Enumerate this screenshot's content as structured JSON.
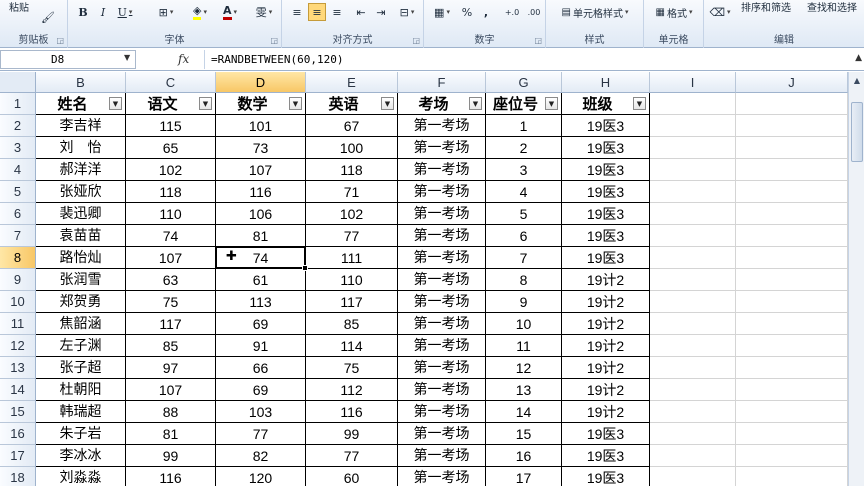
{
  "ribbon": {
    "clipboard": {
      "paste_label": "粘贴",
      "group_label": "剪贴板"
    },
    "font": {
      "group_label": "字体",
      "bold": "B",
      "italic": "I",
      "underline": "U",
      "fill_color": "#ffff00",
      "font_color": "#c00000",
      "font_color_glyph": "A",
      "pinyin_glyph": "雯"
    },
    "alignment": {
      "group_label": "对齐方式"
    },
    "number": {
      "group_label": "数字",
      "percent": "%",
      "comma": ",",
      "inc_decimal": "←.0 .00",
      "dec_decimal": ".00 →.0"
    },
    "styles": {
      "group_label": "样式",
      "cell_styles": "单元格样式"
    },
    "cells": {
      "group_label": "单元格",
      "format": "格式"
    },
    "editing": {
      "group_label": "编辑",
      "sort_filter": "排序和筛选",
      "find_select": "查找和选择"
    }
  },
  "formula_bar": {
    "name_box": "D8",
    "fx": "fx",
    "formula": "=RANDBETWEEN(60,120)"
  },
  "grid": {
    "columns": [
      "B",
      "C",
      "D",
      "E",
      "F",
      "G",
      "H",
      "I",
      "J"
    ],
    "selected_column": "D",
    "selected_row": 8,
    "headers": [
      "姓名",
      "语文",
      "数学",
      "英语",
      "考场",
      "座位号",
      "班级"
    ],
    "rows": [
      {
        "num": "1"
      },
      {
        "num": "2",
        "cells": [
          "李吉祥",
          "115",
          "101",
          "67",
          "第一考场",
          "1",
          "19医3"
        ]
      },
      {
        "num": "3",
        "cells": [
          "刘　怡",
          "65",
          "73",
          "100",
          "第一考场",
          "2",
          "19医3"
        ]
      },
      {
        "num": "4",
        "cells": [
          "郝洋洋",
          "102",
          "107",
          "118",
          "第一考场",
          "3",
          "19医3"
        ]
      },
      {
        "num": "5",
        "cells": [
          "张娅欣",
          "118",
          "116",
          "71",
          "第一考场",
          "4",
          "19医3"
        ]
      },
      {
        "num": "6",
        "cells": [
          "裴迅卿",
          "110",
          "106",
          "102",
          "第一考场",
          "5",
          "19医3"
        ]
      },
      {
        "num": "7",
        "cells": [
          "袁苗苗",
          "74",
          "81",
          "77",
          "第一考场",
          "6",
          "19医3"
        ]
      },
      {
        "num": "8",
        "cells": [
          "路怡灿",
          "107",
          "74",
          "111",
          "第一考场",
          "7",
          "19医3"
        ]
      },
      {
        "num": "9",
        "cells": [
          "张润雪",
          "63",
          "61",
          "110",
          "第一考场",
          "8",
          "19计2"
        ]
      },
      {
        "num": "10",
        "cells": [
          "郑贺勇",
          "75",
          "113",
          "117",
          "第一考场",
          "9",
          "19计2"
        ]
      },
      {
        "num": "11",
        "cells": [
          "焦韶涵",
          "117",
          "69",
          "85",
          "第一考场",
          "10",
          "19计2"
        ]
      },
      {
        "num": "12",
        "cells": [
          "左子渊",
          "85",
          "91",
          "114",
          "第一考场",
          "11",
          "19计2"
        ]
      },
      {
        "num": "13",
        "cells": [
          "张子超",
          "97",
          "66",
          "75",
          "第一考场",
          "12",
          "19计2"
        ]
      },
      {
        "num": "14",
        "cells": [
          "杜朝阳",
          "107",
          "69",
          "112",
          "第一考场",
          "13",
          "19计2"
        ]
      },
      {
        "num": "15",
        "cells": [
          "韩瑞超",
          "88",
          "103",
          "116",
          "第一考场",
          "14",
          "19计2"
        ]
      },
      {
        "num": "16",
        "cells": [
          "朱子岩",
          "81",
          "77",
          "99",
          "第一考场",
          "15",
          "19医3"
        ]
      },
      {
        "num": "17",
        "cells": [
          "李冰冰",
          "99",
          "82",
          "77",
          "第一考场",
          "16",
          "19医3"
        ]
      },
      {
        "num": "18",
        "cells": [
          "刘淼淼",
          "116",
          "120",
          "60",
          "第一考场",
          "17",
          "19医3"
        ]
      }
    ]
  },
  "colors": {
    "selection_header": "#f8c766",
    "ribbon": "#dfe9f5",
    "gridline": "#d4d4d4"
  }
}
